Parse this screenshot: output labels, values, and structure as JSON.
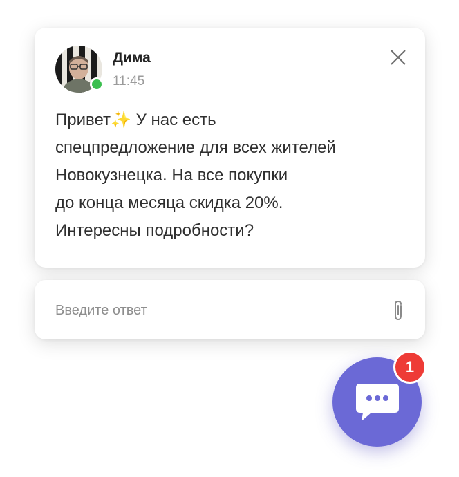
{
  "message": {
    "sender_name": "Дима",
    "time": "11:45",
    "text": "Привет✨ У нас есть\nспецпредложение для всех жителей\nНовокузнецка. На все покупки\nдо конца месяца скидка 20%.\nИнтересны подробности?"
  },
  "reply": {
    "placeholder": "Введите ответ"
  },
  "launcher": {
    "badge_count": "1"
  },
  "colors": {
    "accent": "#6b69d6",
    "badge": "#ee3b36",
    "online": "#3bbf4f"
  },
  "icons": [
    "close-icon",
    "paperclip-icon",
    "chat-bubble-icon"
  ]
}
